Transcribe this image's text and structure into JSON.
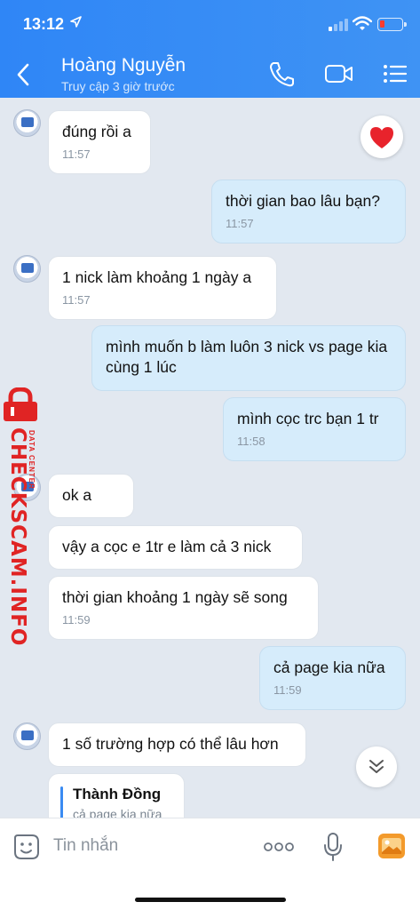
{
  "status_bar": {
    "time": "13:12"
  },
  "header": {
    "name": "Hoàng Nguyễn",
    "status": "Truy cập 3 giờ trước"
  },
  "messages": [
    {
      "side": "in",
      "text": "đúng rồi a",
      "time": "11:57"
    },
    {
      "side": "out",
      "text": "thời gian bao lâu bạn?",
      "time": "11:57"
    },
    {
      "side": "in",
      "text": "1 nick làm khoảng 1 ngày a",
      "time": "11:57"
    },
    {
      "side": "out",
      "text": "mình muốn b làm luôn 3 nick vs page kia cùng 1 lúc",
      "time": ""
    },
    {
      "side": "out",
      "text": "mình cọc trc bạn 1 tr",
      "time": "11:58"
    },
    {
      "side": "in",
      "text": "ok a",
      "time": ""
    },
    {
      "side": "in",
      "text": "vậy a cọc e 1tr e làm cả 3 nick",
      "time": ""
    },
    {
      "side": "in",
      "text": "thời gian khoảng 1 ngày sẽ song",
      "time": "11:59"
    },
    {
      "side": "out",
      "text": "cả page kia nữa",
      "time": "11:59"
    },
    {
      "side": "in",
      "text": "1 số trường hợp có thể lâu hơn",
      "time": ""
    }
  ],
  "reply_preview": {
    "name": "Thành Đồng",
    "text": "cả page kia nữa"
  },
  "watermark": {
    "brand": "CHECKSCAM.INFO",
    "sub": "DATA CENTER"
  },
  "input": {
    "placeholder": "Tin nhắn"
  },
  "icons": {
    "back": "chevron-left-icon",
    "call": "phone-icon",
    "video": "video-camera-icon",
    "menu": "list-menu-icon",
    "reaction": "heart-icon",
    "scroll": "double-chevron-down-icon",
    "sticker": "sticker-face-icon",
    "more": "more-dots-icon",
    "mic": "microphone-icon",
    "image": "image-icon"
  },
  "colors": {
    "header": "#3a8ef5",
    "outgoing_bubble": "#d6ecfb",
    "incoming_bubble": "#ffffff",
    "watermark": "#e02424"
  }
}
